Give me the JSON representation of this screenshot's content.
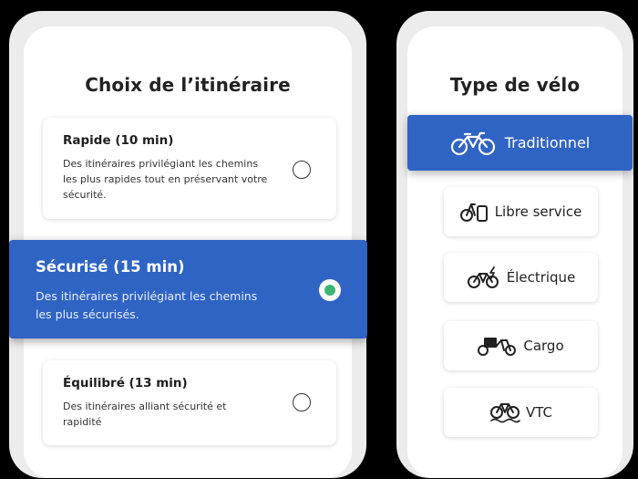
{
  "route_panel": {
    "title": "Choix de l’itinéraire",
    "options": [
      {
        "title": "Rapide (10 min)",
        "description": "Des itinéraires privilégiant les chemins les plus rapides tout en préservant votre sécurité.",
        "selected": false
      },
      {
        "title": "Sécurisé (15 min)",
        "description": "Des itinéraires privilégiant les chemins les plus sécurisés.",
        "selected": true
      },
      {
        "title": "Équilibré (13 min)",
        "description": "Des itinéraires alliant sécurité et rapidité",
        "selected": false
      }
    ]
  },
  "bike_panel": {
    "title": "Type de vélo",
    "options": [
      {
        "label": "Traditionnel",
        "icon": "bicycle-icon",
        "selected": true
      },
      {
        "label": "Libre service",
        "icon": "shared-bike-icon",
        "selected": false
      },
      {
        "label": "Électrique",
        "icon": "electric-bike-icon",
        "selected": false
      },
      {
        "label": "Cargo",
        "icon": "cargo-bike-icon",
        "selected": false
      },
      {
        "label": "VTC",
        "icon": "hybrid-bike-icon",
        "selected": false
      }
    ]
  },
  "colors": {
    "accent": "#2f63c4",
    "radio_selected": "#3bb673"
  }
}
